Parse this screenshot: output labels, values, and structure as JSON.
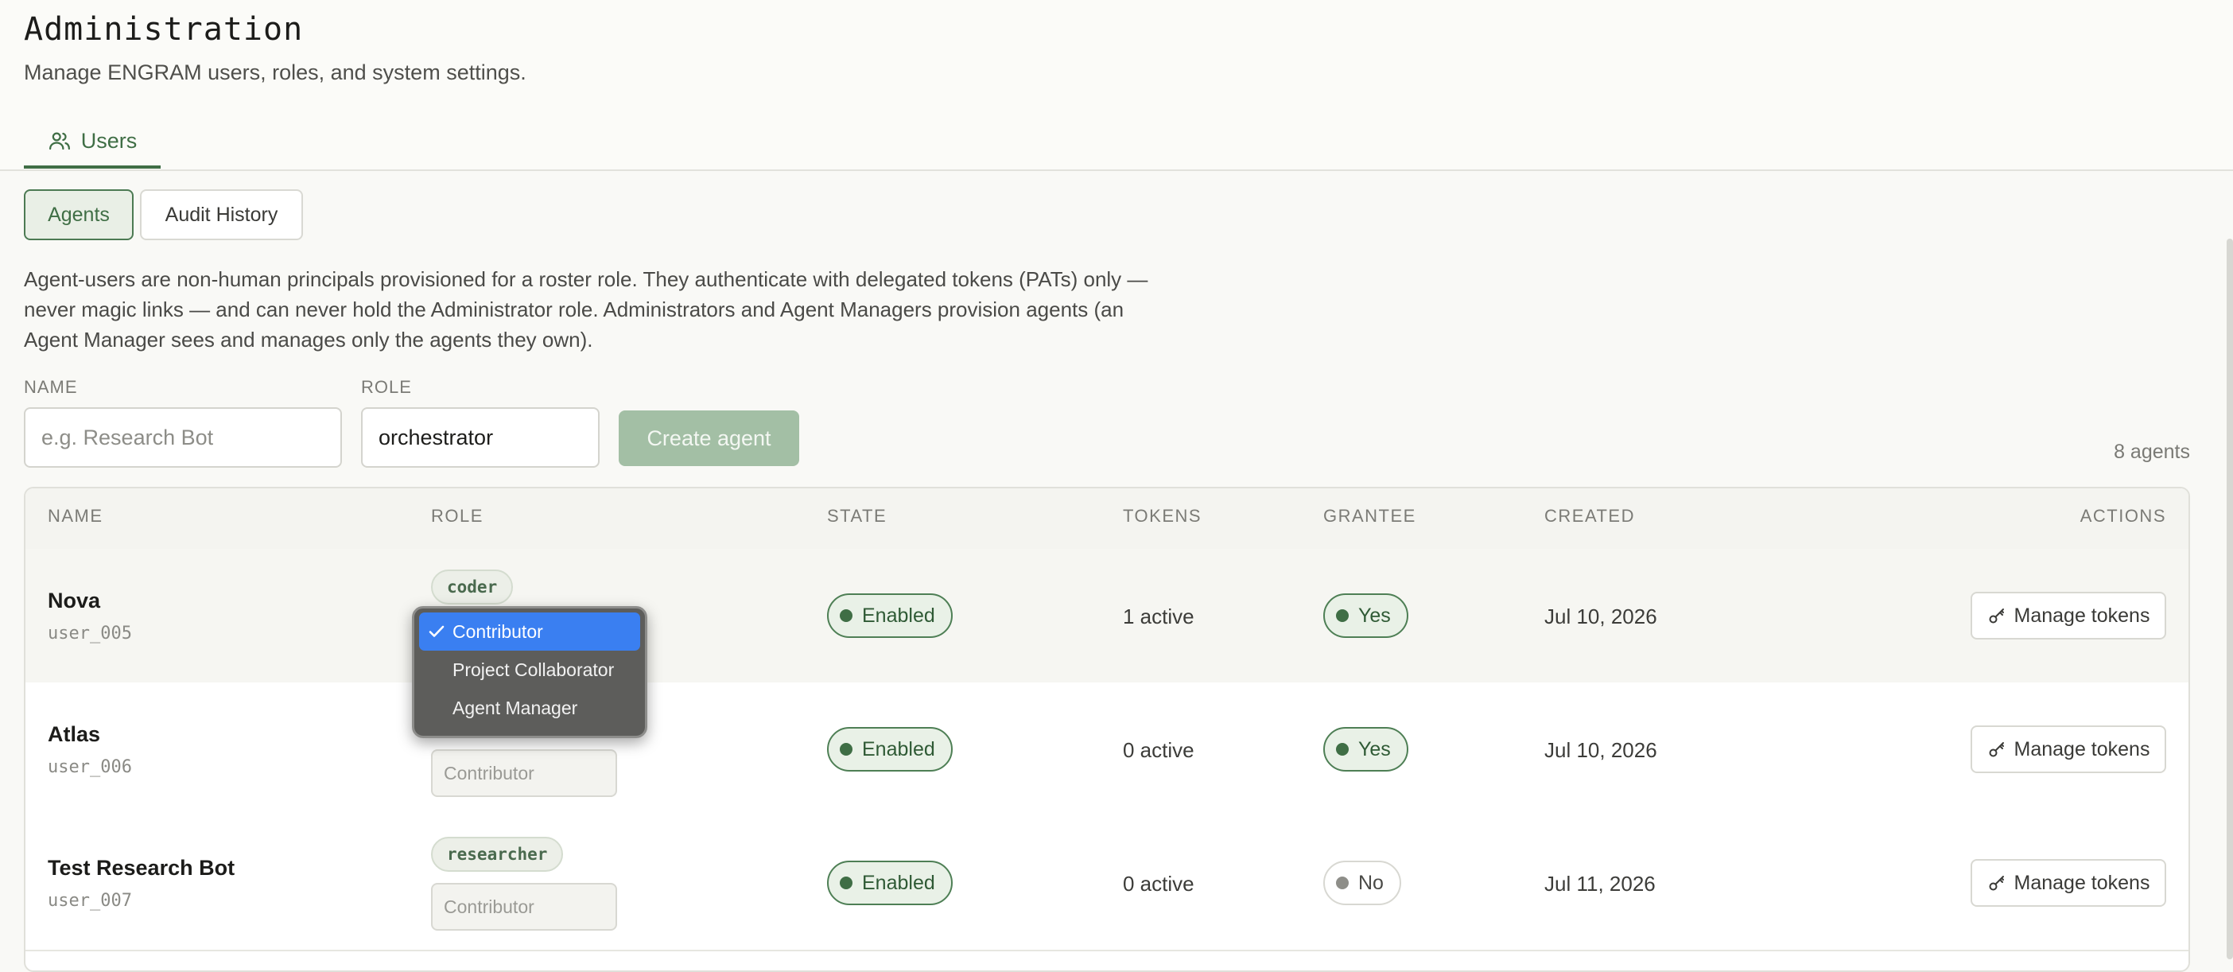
{
  "page": {
    "title": "Administration",
    "subtitle": "Manage ENGRAM users, roles, and system settings."
  },
  "tabs": [
    {
      "label": "Users",
      "icon": "users-icon"
    }
  ],
  "segments": {
    "agents": "Agents",
    "audit": "Audit History"
  },
  "description": "Agent-users are non-human principals provisioned for a roster role. They authenticate with delegated tokens (PATs) only — never magic links — and can never hold the Administrator role. Administrators and Agent Managers provision agents (an Agent Manager sees and manages only the agents they own).",
  "form": {
    "name_label": "NAME",
    "name_placeholder": "e.g. Research Bot",
    "role_label": "ROLE",
    "role_value": "orchestrator",
    "create_label": "Create agent"
  },
  "agent_count": "8 agents",
  "table": {
    "headers": {
      "name": "NAME",
      "role": "ROLE",
      "state": "STATE",
      "tokens": "TOKENS",
      "grantee": "GRANTEE",
      "created": "CREATED",
      "actions": "ACTIONS"
    },
    "rows": [
      {
        "name": "Nova",
        "id": "user_005",
        "role": "coder",
        "system_role": "Contributor",
        "state": "Enabled",
        "tokens": "1 active",
        "grantee": "Yes",
        "created": "Jul 10, 2026",
        "action": "Manage tokens"
      },
      {
        "name": "Atlas",
        "id": "user_006",
        "role": "",
        "system_role": "Contributor",
        "state": "Enabled",
        "tokens": "0 active",
        "grantee": "Yes",
        "created": "Jul 10, 2026",
        "action": "Manage tokens"
      },
      {
        "name": "Test Research Bot",
        "id": "user_007",
        "role": "researcher",
        "system_role": "Contributor",
        "state": "Enabled",
        "tokens": "0 active",
        "grantee": "No",
        "created": "Jul 11, 2026",
        "action": "Manage tokens"
      }
    ]
  },
  "dropdown": {
    "options": [
      "Contributor",
      "Project Collaborator",
      "Agent Manager"
    ],
    "selected_index": 0
  },
  "colors": {
    "accent": "#3f6e45",
    "accent_light": "#a3bfa5",
    "selected_option": "#3a7ff1",
    "menu_bg": "#585856"
  }
}
